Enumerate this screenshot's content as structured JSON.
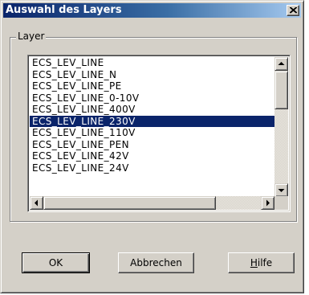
{
  "window": {
    "title": "Auswahl des Layers"
  },
  "group": {
    "label": "Layer"
  },
  "layers": {
    "items": [
      "ECS_LEV_LINE",
      "ECS_LEV_LINE_N",
      "ECS_LEV_LINE_PE",
      "ECS_LEV_LINE_0-10V",
      "ECS_LEV_LINE_400V",
      "ECS_LEV_LINE_230V",
      "ECS_LEV_LINE_110V",
      "ECS_LEV_LINE_PEN",
      "ECS_LEV_LINE_42V",
      "ECS_LEV_LINE_24V"
    ],
    "selected_index": 5
  },
  "buttons": {
    "ok": "OK",
    "cancel": "Abbrechen",
    "help_mnemonic": "H",
    "help_rest": "ilfe"
  },
  "icons": {
    "close": "close-icon",
    "scroll_up": "arrow-up-icon",
    "scroll_down": "arrow-down-icon",
    "scroll_left": "arrow-left-icon",
    "scroll_right": "arrow-right-icon"
  },
  "colors": {
    "title_bar": "#0a246a",
    "selection": "#0a246a",
    "face": "#d4d0c8"
  }
}
